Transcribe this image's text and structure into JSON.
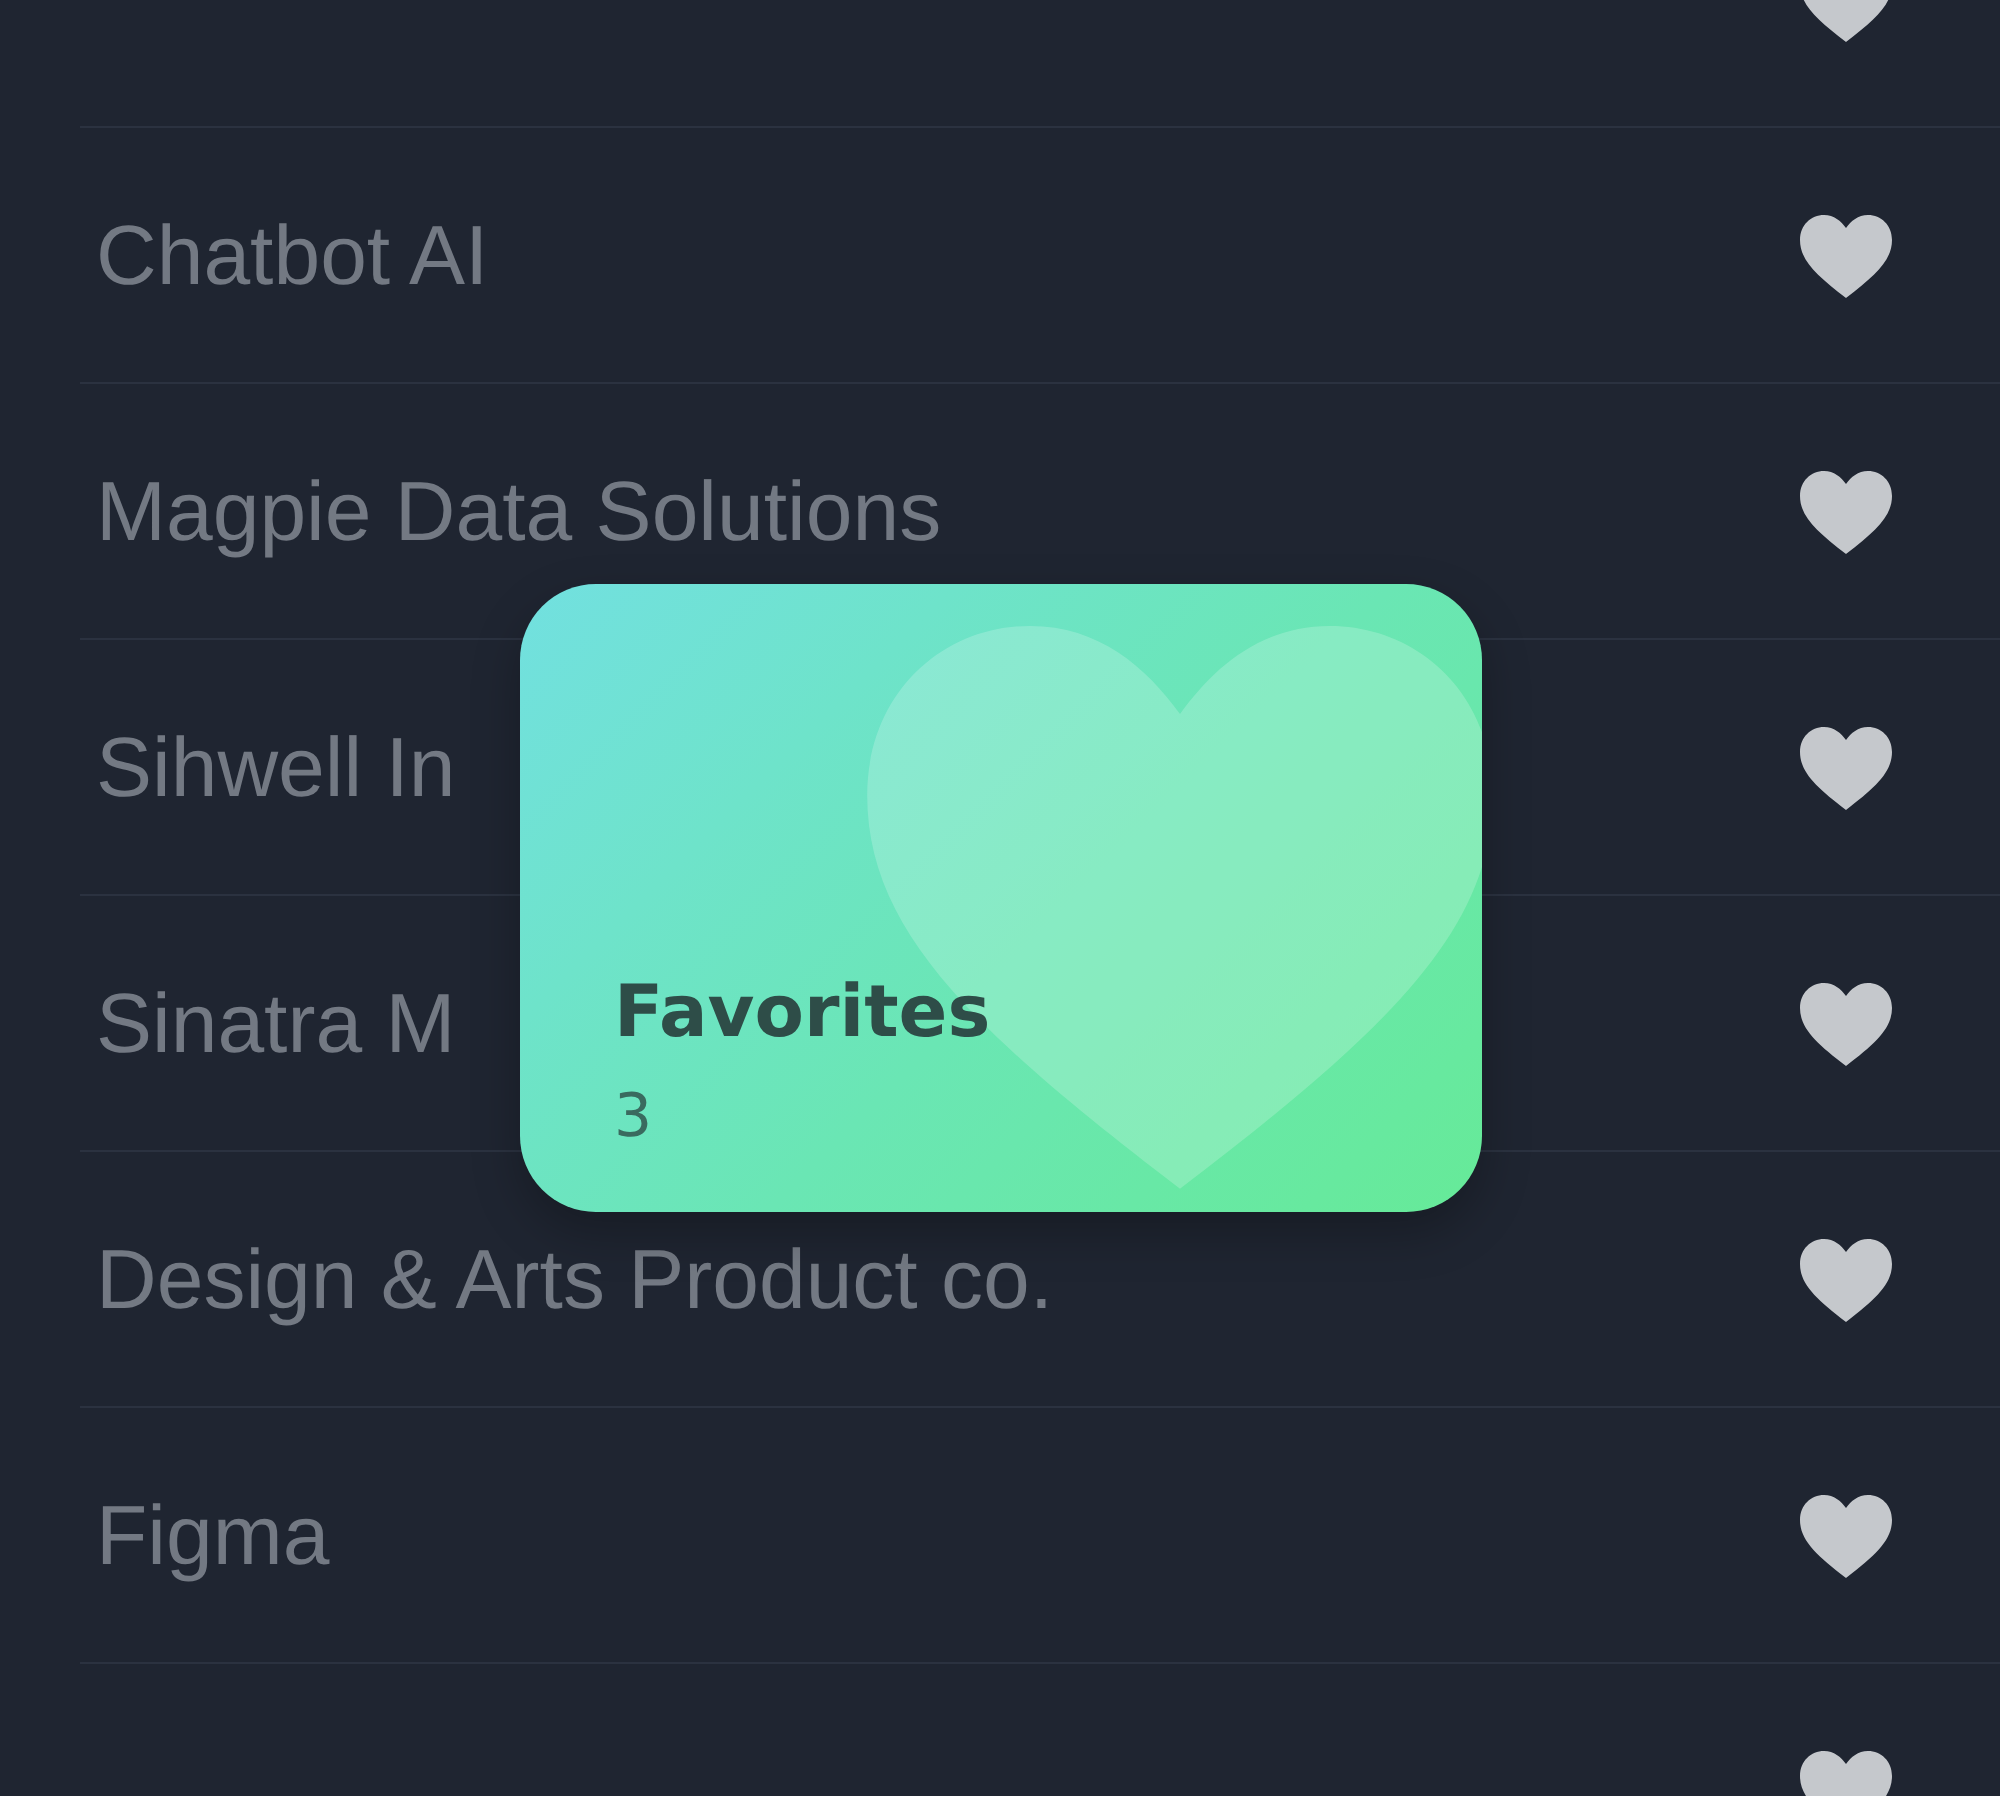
{
  "list": {
    "rows": [
      {
        "name": null
      },
      {
        "name": "Chatbot AI"
      },
      {
        "name": "Magpie Data Solutions"
      },
      {
        "name": "Sihwell In"
      },
      {
        "name": "Sinatra M"
      },
      {
        "name": "Design & Arts Product co."
      },
      {
        "name": "Figma"
      },
      {
        "name": null
      }
    ]
  },
  "card": {
    "title": "Favorites",
    "count": "3"
  }
}
